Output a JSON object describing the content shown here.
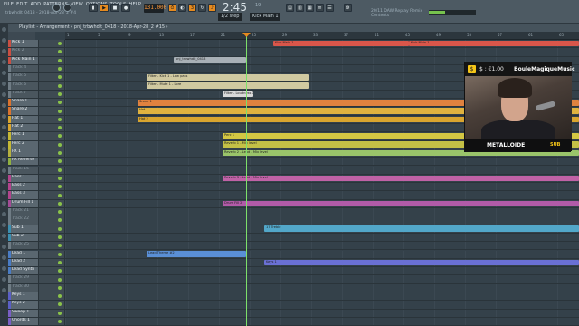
{
  "app": {
    "menu": [
      "FILE",
      "EDIT",
      "ADD",
      "PATTERNS",
      "VIEW",
      "OPTIONS",
      "TOOLS",
      "HELP"
    ],
    "song_file": "trbwhdlt_0418 - 2018-Apr-28_2 #4"
  },
  "transport": {
    "tempo": "131.000",
    "time": "2:45",
    "time_sub": "19",
    "snap": "1/2 step",
    "pattern": "Kick Main 1"
  },
  "hint": {
    "line1": "20/11  DAW Replay Remix",
    "line2": "Contents"
  },
  "colors": {
    "accent": "#e58a1f",
    "playhead": "#7de06a",
    "bg": "#34414a"
  },
  "playlist": {
    "title": "Playlist - Arrangement › pnj_trbwhdlt_0418 - 2018-Apr-28_2 #15 ›",
    "ruler": [
      "1",
      "5",
      "9",
      "13",
      "17",
      "21",
      "25",
      "29",
      "33",
      "37",
      "41",
      "45",
      "49",
      "53",
      "57",
      "61",
      "65"
    ],
    "tracks": [
      {
        "name": "Kick 1",
        "color": "#c94f43",
        "dim": false
      },
      {
        "name": "Kick 2",
        "color": "#c94f43",
        "dim": true
      },
      {
        "name": "Kick Main 1",
        "color": "#c94f43",
        "dim": false
      },
      {
        "name": "Track 4",
        "color": "#6f7c85",
        "dim": true
      },
      {
        "name": "Track 5",
        "color": "#6f7c85",
        "dim": true
      },
      {
        "name": "Track 6",
        "color": "#6f7c85",
        "dim": true
      },
      {
        "name": "Track 7",
        "color": "#6f7c85",
        "dim": true
      },
      {
        "name": "Snare 1",
        "color": "#d9732f",
        "dim": false
      },
      {
        "name": "Snare 2",
        "color": "#d9732f",
        "dim": false
      },
      {
        "name": "Hat 1",
        "color": "#d9a52f",
        "dim": false
      },
      {
        "name": "Hat 2",
        "color": "#d9a52f",
        "dim": false
      },
      {
        "name": "Perc 1",
        "color": "#c4b836",
        "dim": false
      },
      {
        "name": "Perc 2",
        "color": "#c4b836",
        "dim": false
      },
      {
        "name": "FX 1",
        "color": "#b5b040",
        "dim": false
      },
      {
        "name": "FX Reverse",
        "color": "#90b040",
        "dim": false
      },
      {
        "name": "Track 16",
        "color": "#6f7c85",
        "dim": true
      },
      {
        "name": "Bass 1",
        "color": "#b2458d",
        "dim": false
      },
      {
        "name": "Bass 2",
        "color": "#b2458d",
        "dim": false
      },
      {
        "name": "Bass 3",
        "color": "#b2458d",
        "dim": false
      },
      {
        "name": "Drum Fill 1",
        "color": "#a34c96",
        "dim": false
      },
      {
        "name": "Track 21",
        "color": "#6f7c85",
        "dim": true
      },
      {
        "name": "Track 22",
        "color": "#6f7c85",
        "dim": true
      },
      {
        "name": "Sub 1",
        "color": "#3c8fb0",
        "dim": false
      },
      {
        "name": "Sub 2",
        "color": "#3c8fb0",
        "dim": false
      },
      {
        "name": "Track 25",
        "color": "#6f7c85",
        "dim": true
      },
      {
        "name": "Lead 1",
        "color": "#4a7cc4",
        "dim": false
      },
      {
        "name": "Lead 2",
        "color": "#4a7cc4",
        "dim": false
      },
      {
        "name": "Lead Synth",
        "color": "#4a7cc4",
        "dim": false
      },
      {
        "name": "Track 29",
        "color": "#6f7c85",
        "dim": true
      },
      {
        "name": "Track 30",
        "color": "#6f7c85",
        "dim": true
      },
      {
        "name": "Keys 1",
        "color": "#5a5fc4",
        "dim": false
      },
      {
        "name": "Keys 2",
        "color": "#5a5fc4",
        "dim": false
      },
      {
        "name": "Sweep 1",
        "color": "#7a5fc4",
        "dim": false
      },
      {
        "name": "Chords 1",
        "color": "#7a5fc4",
        "dim": false
      }
    ],
    "clips": [
      {
        "row": 0,
        "text": "Kick Main 1",
        "color": "#d9564a"
      },
      {
        "row": 0,
        "text": "Kick Main 1",
        "color": "#d9564a"
      },
      {
        "row": 2,
        "text": "pnj_trbwhdlt_0418",
        "color": "#a8b0b6"
      },
      {
        "row": 4,
        "text": "Filter - Kick 1 - Low pass",
        "color": "#d0c9a0"
      },
      {
        "row": 5,
        "text": "Filter - Mute 1 - Lore",
        "color": "#d0c9a0"
      },
      {
        "row": 6,
        "text": "Filter - Loudness Cutoff frequency",
        "color": "#d9d9d9"
      },
      {
        "row": 7,
        "text": "Snare 1",
        "color": "#e0823f"
      },
      {
        "row": 8,
        "text": "Hat 1",
        "color": "#e0b23f"
      },
      {
        "row": 9,
        "text": "Hat 2",
        "color": "#d9a52f"
      },
      {
        "row": 11,
        "text": "Perc 1",
        "color": "#d4c743"
      },
      {
        "row": 12,
        "text": "Reverb 1 - Mix level",
        "color": "#c4c046"
      },
      {
        "row": 13,
        "text": "Reverb 2 - Lead - Mix level",
        "color": "#9ac46a"
      },
      {
        "row": 16,
        "text": "Reverb 3 - Lead - Mix level",
        "color": "#c062a6"
      },
      {
        "row": 19,
        "text": "Drum Fill 2",
        "color": "#b15ba8"
      },
      {
        "row": 22,
        "text": "17 Treble",
        "color": "#52a7c9"
      },
      {
        "row": 25,
        "text": "Lead Theme #2",
        "color": "#5a8fd6"
      },
      {
        "row": 26,
        "text": "Keys 1",
        "color": "#6a70d4"
      }
    ]
  },
  "stream": {
    "currency_amount": "$ : €1.00",
    "username": "BouleMagiqueMusic",
    "streamer": "METALLOIDE",
    "badge": "SUB"
  }
}
